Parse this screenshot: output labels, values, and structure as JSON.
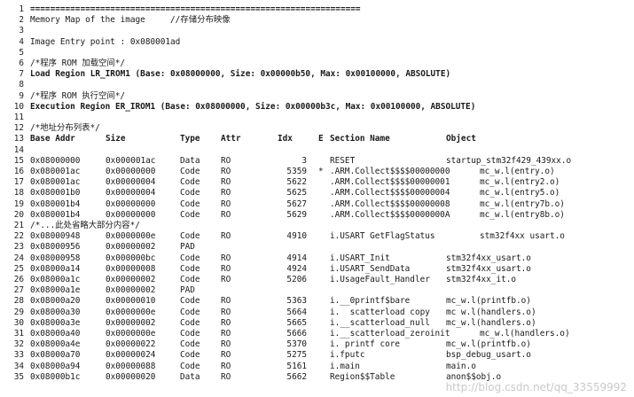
{
  "rule": "==================================================================",
  "header_lines": [
    {
      "ln": "1",
      "type": "rule"
    },
    {
      "ln": "2",
      "text": "Memory Map of the image     //存储分布映像",
      "bold": false
    },
    {
      "ln": "3",
      "text": ""
    },
    {
      "ln": "4",
      "text": "Image Entry point : 0x080001ad",
      "bold": false
    },
    {
      "ln": "5",
      "text": ""
    },
    {
      "ln": "6",
      "text": "/*程序 ROM 加载空间*/",
      "bold": false
    },
    {
      "ln": "7",
      "text": "Load Region LR_IROM1 (Base: 0x08000000, Size: 0x00000b50, Max: 0x00100000, ABSOLUTE)",
      "bold": true
    },
    {
      "ln": "8",
      "text": ""
    },
    {
      "ln": "9",
      "text": "/*程序 ROM 执行空间*/",
      "bold": false
    },
    {
      "ln": "10",
      "text": "Execution Region ER_IROM1 (Base: 0x08000000, Size: 0x00000b3c, Max: 0x00100000, ABSOLUTE)",
      "bold": true
    },
    {
      "ln": "11",
      "text": ""
    },
    {
      "ln": "12",
      "text": "/*地址分布列表*/",
      "bold": false
    }
  ],
  "table_header": {
    "ln": "13",
    "cols": [
      "Base Addr",
      "Size",
      "Type",
      "Attr",
      "Idx",
      "E",
      "Section Name",
      "Object"
    ]
  },
  "rows": [
    {
      "ln": "14",
      "kind": "blank"
    },
    {
      "ln": "15",
      "addr": "0x08000000",
      "size": "0x000001ac",
      "type": "Data",
      "attr": "RO",
      "idx": "3",
      "e": "",
      "name": "RESET",
      "obj": "startup_stm32f429_439xx.o"
    },
    {
      "ln": "16",
      "addr": "0x080001ac",
      "size": "0x00000000",
      "type": "Code",
      "attr": "RO",
      "idx": "5359",
      "e": "*",
      "name": ".ARM.Collect$$$$00000000",
      "obj": "mc_w.l(entry.o)"
    },
    {
      "ln": "17",
      "addr": "0x080001ac",
      "size": "0x00000004",
      "type": "Code",
      "attr": "RO",
      "idx": "5622",
      "e": "",
      "name": ".ARM.Collect$$$$00000001",
      "obj": "mc_w.l(entry2.o)"
    },
    {
      "ln": "18",
      "addr": "0x080001b0",
      "size": "0x00000004",
      "type": "Code",
      "attr": "RO",
      "idx": "5625",
      "e": "",
      "name": ".ARM.Collect$$$$00000004",
      "obj": "mc_w.l(entry5.o)"
    },
    {
      "ln": "19",
      "addr": "0x080001b4",
      "size": "0x00000000",
      "type": "Code",
      "attr": "RO",
      "idx": "5627",
      "e": "",
      "name": ".ARM.Collect$$$$00000008",
      "obj": "mc_w.l(entry7b.o)"
    },
    {
      "ln": "20",
      "addr": "0x080001b4",
      "size": "0x00000000",
      "type": "Code",
      "attr": "RO",
      "idx": "5629",
      "e": "",
      "name": ".ARM.Collect$$$$0000000A",
      "obj": "mc_w.l(entry8b.o)"
    },
    {
      "ln": "21",
      "kind": "comment",
      "text": "/*...此处省略大部分内容*/"
    },
    {
      "ln": "22",
      "addr": "0x08000948",
      "size": "0x0000000e",
      "type": "Code",
      "attr": "RO",
      "idx": "4910",
      "e": "",
      "name": "i.USART GetFlagStatus",
      "obj": "stm32f4xx usart.o"
    },
    {
      "ln": "23",
      "addr": "0x08000956",
      "size": "0x00000002",
      "type": "PAD",
      "attr": "",
      "idx": "",
      "e": "",
      "name": "",
      "obj": ""
    },
    {
      "ln": "24",
      "addr": "0x08000958",
      "size": "0x000000bc",
      "type": "Code",
      "attr": "RO",
      "idx": "4914",
      "e": "",
      "name": "i.USART_Init",
      "obj": "stm32f4xx_usart.o"
    },
    {
      "ln": "25",
      "addr": "0x08000a14",
      "size": "0x00000008",
      "type": "Code",
      "attr": "RO",
      "idx": "4924",
      "e": "",
      "name": "i.USART_SendData",
      "obj": "stm32f4xx_usart.o"
    },
    {
      "ln": "26",
      "addr": "0x08000a1c",
      "size": "0x00000002",
      "type": "Code",
      "attr": "RO",
      "idx": "5206",
      "e": "",
      "name": "i.UsageFault_Handler",
      "obj": "stm32f4xx_it.o"
    },
    {
      "ln": "27",
      "addr": "0x08000a1e",
      "size": "0x00000002",
      "type": "PAD",
      "attr": "",
      "idx": "",
      "e": "",
      "name": "",
      "obj": ""
    },
    {
      "ln": "28",
      "addr": "0x08000a20",
      "size": "0x00000010",
      "type": "Code",
      "attr": "RO",
      "idx": "5363",
      "e": "",
      "name": "i.__0printf$bare",
      "obj": "mc_w.l(printfb.o)"
    },
    {
      "ln": "29",
      "addr": "0x08000a30",
      "size": "0x0000000e",
      "type": "Code",
      "attr": "RO",
      "idx": "5664",
      "e": "",
      "name": "i.  scatterload copy",
      "obj": "mc w.l(handlers.o)"
    },
    {
      "ln": "30",
      "addr": "0x08000a3e",
      "size": "0x00000002",
      "type": "Code",
      "attr": "RO",
      "idx": "5665",
      "e": "",
      "name": "i.__scatterload_null",
      "obj": "mc_w.l(handlers.o)"
    },
    {
      "ln": "31",
      "addr": "0x08000a40",
      "size": "0x0000000e",
      "type": "Code",
      "attr": "RO",
      "idx": "5666",
      "e": "",
      "name": "i.__scatterload_zeroinit",
      "obj": "mc_w.l(handlers.o)"
    },
    {
      "ln": "32",
      "addr": "0x08000a4e",
      "size": "0x00000022",
      "type": "Code",
      "attr": "RO",
      "idx": "5370",
      "e": "",
      "name": "i. printf core",
      "obj": "mc_w.l(printfb.o)"
    },
    {
      "ln": "33",
      "addr": "0x08000a70",
      "size": "0x00000024",
      "type": "Code",
      "attr": "RO",
      "idx": "5275",
      "e": "",
      "name": "i.fputc",
      "obj": "bsp_debug_usart.o"
    },
    {
      "ln": "34",
      "addr": "0x08000a94",
      "size": "0x00000088",
      "type": "Code",
      "attr": "RO",
      "idx": "5161",
      "e": "",
      "name": "i.main",
      "obj": "main.o"
    },
    {
      "ln": "35",
      "addr": "0x08000b1c",
      "size": "0x00000020",
      "type": "Data",
      "attr": "RO",
      "idx": "5662",
      "e": "",
      "name": "Region$$Table",
      "obj": "anon$$obj.o"
    }
  ],
  "watermark": "http://blog.csdn.net/qq_33559992"
}
